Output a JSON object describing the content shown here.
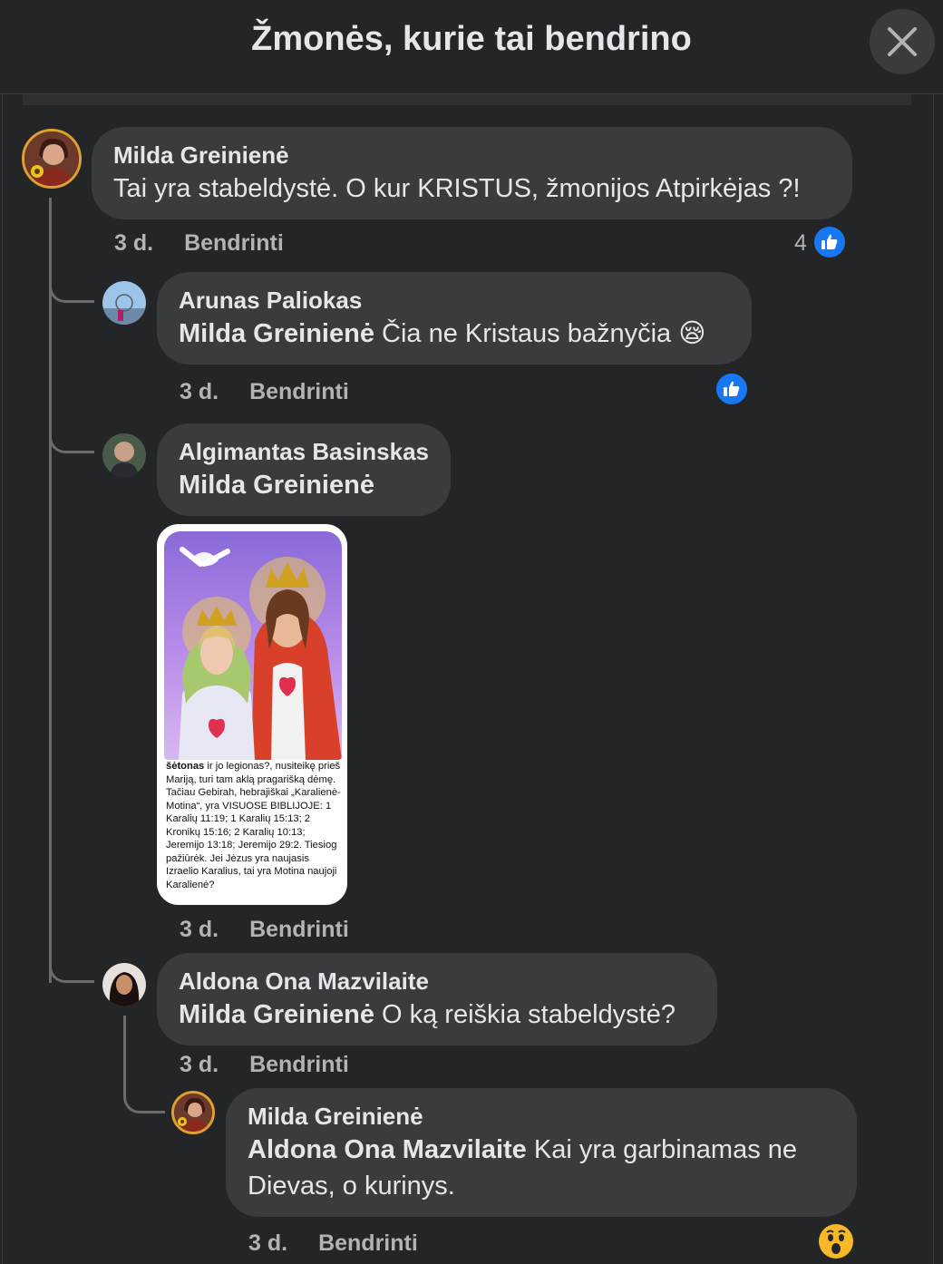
{
  "header": {
    "title": "Žmonės, kurie tai bendrino"
  },
  "comments": [
    {
      "author": "Milda Greinienė",
      "text": "Tai yra stabeldystė. O kur KRISTUS, žmonijos Atpirkėjas ?!",
      "time": "3 d.",
      "action": "Bendrinti",
      "reaction_count": "4"
    },
    {
      "author": "Arunas Paliokas",
      "mention": "Milda Greinienė",
      "text": " Čia ne Kristaus bažnyčia 😪",
      "time": "3 d.",
      "action": "Bendrinti"
    },
    {
      "author": "Algimantas Basinskas",
      "mention": "Milda Greinienė",
      "time": "3 d.",
      "action": "Bendrinti",
      "image_caption_bold": "šėtonas",
      "image_caption": " ir jo legionas?, nusiteikę prieš Mariją, turi tam aklą pragarišką dėmę. Tačiau Gebirah, hebrajiškai „Karalienė-Motina“, yra VISUOSE BIBLIJOJE: 1 Karalių 11:19; 1 Karalių 15:13; 2 Kronikų 15:16; 2 Karalių 10:13; Jeremijo 13:18; Jeremijo 29:2. Tiesiog pažiūrėk. Jei Jėzus yra naujasis Izraelio Karalius, tai yra Motina naujoji Karalienė?"
    },
    {
      "author": "Aldona Ona Mazvilaite",
      "mention": "Milda Greinienė",
      "text": " O ką reiškia stabeldystė?",
      "time": "3 d.",
      "action": "Bendrinti"
    },
    {
      "author": "Milda Greinienė",
      "mention": "Aldona Ona Mazvilaite",
      "text": " Kai yra garbinamas ne Dievas, o kurinys.",
      "time": "3 d.",
      "action": "Bendrinti"
    }
  ],
  "colors": {
    "background": "#242526",
    "bubble": "#3a3b3c",
    "like_blue": "#1877f2"
  },
  "icons": [
    "close-icon",
    "like-icon",
    "wow-reaction-icon"
  ]
}
